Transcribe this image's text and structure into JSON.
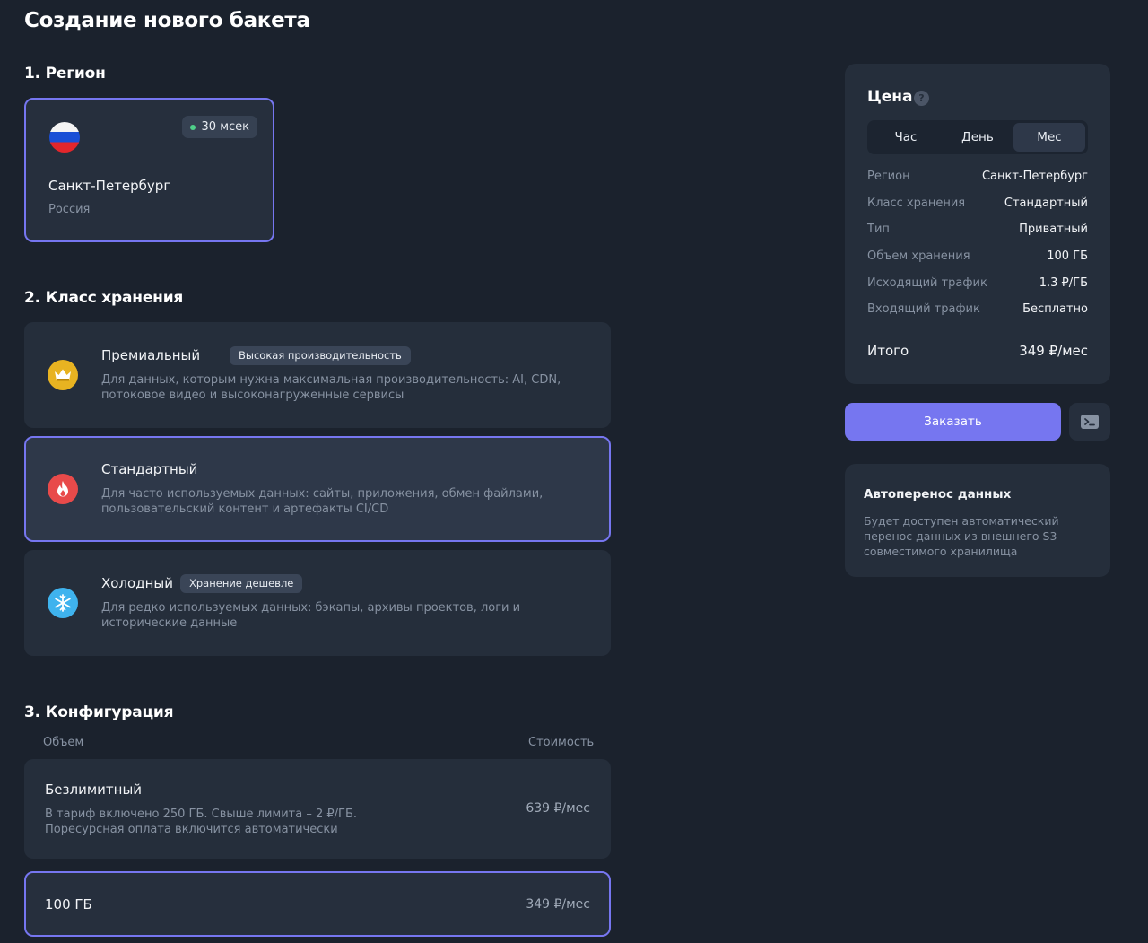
{
  "page": {
    "title": "Создание нового бакета"
  },
  "region": {
    "section_title": "1. Регион",
    "card": {
      "latency": "30 мсек",
      "city": "Санкт-Петербург",
      "country": "Россия"
    }
  },
  "storage_class": {
    "section_title": "2. Класс хранения",
    "items": [
      {
        "name": "Премиальный",
        "badge": "Высокая производительность",
        "description": "Для данных, которым нужна максимальная производительность: AI, CDN, потоковое видео и высоконагруженные сервисы",
        "icon": "crown-icon",
        "color": "#e8b321"
      },
      {
        "name": "Стандартный",
        "badge": "",
        "description": "Для часто используемых данных: сайты, приложения, обмен файлами, пользовательский контент и артефакты CI/CD",
        "icon": "flame-icon",
        "color": "#e84a4a"
      },
      {
        "name": "Холодный",
        "badge": "Хранение дешевле",
        "description": "Для редко используемых данных: бэкапы, архивы проектов, логи и исторические данные",
        "icon": "snowflake-icon",
        "color": "#3fb3ee"
      }
    ]
  },
  "configuration": {
    "section_title": "3. Конфигурация",
    "col_volume": "Объем",
    "col_cost": "Стоимость",
    "items": [
      {
        "name": "Безлимитный",
        "description_line1": "В тариф включено 250 ГБ. Свыше лимита – 2 ₽/ГБ.",
        "description_line2": "Поресурсная оплата включится автоматически",
        "price": "639 ₽/мес"
      },
      {
        "name": "100 ГБ",
        "price": "349 ₽/мес"
      }
    ]
  },
  "price": {
    "title": "Цена",
    "help": "?",
    "periods": [
      "Час",
      "День",
      "Мес"
    ],
    "rows": [
      {
        "label": "Регион",
        "value": "Санкт-Петербург"
      },
      {
        "label": "Класс хранения",
        "value": "Стандартный"
      },
      {
        "label": "Тип",
        "value": "Приватный"
      },
      {
        "label": "Объем хранения",
        "value": "100 ГБ"
      },
      {
        "label": "Исходящий трафик",
        "value": "1.3 ₽/ГБ"
      },
      {
        "label": "Входящий трафик",
        "value": "Бесплатно"
      }
    ],
    "total_label": "Итого",
    "total_value": "349 ₽/мес"
  },
  "actions": {
    "order_label": "Заказать",
    "terminal_icon": "terminal-icon"
  },
  "auto_transfer": {
    "title": "Автоперенос данных",
    "text": "Будет доступен автоматический перенос данных из внешнего S3-совместимого хранилища"
  },
  "colors": {
    "accent": "#7676f0",
    "background": "#1b222d",
    "card": "#252e3b"
  }
}
